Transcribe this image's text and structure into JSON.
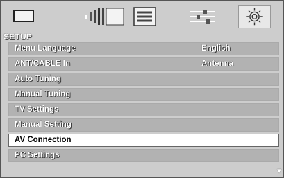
{
  "topbar": {
    "icons": [
      "picture-icon",
      "sound-icon",
      "channel-icon",
      "features-icon",
      "setup-gear-icon"
    ]
  },
  "menu": {
    "title": "SETUP",
    "items": [
      {
        "label": "Menu Language",
        "value": "English"
      },
      {
        "label": "ANT/CABLE In",
        "value": "Antenna"
      },
      {
        "label": "Auto Tuning",
        "value": ""
      },
      {
        "label": "Manual Tuning",
        "value": ""
      },
      {
        "label": "TV Settings",
        "value": ""
      },
      {
        "label": "Manual Setting",
        "value": ""
      },
      {
        "label": "AV Connection",
        "value": "",
        "selected": true
      },
      {
        "label": "PC Settings",
        "value": ""
      }
    ]
  },
  "scroll": {
    "indicator": "down-arrow-icon"
  }
}
